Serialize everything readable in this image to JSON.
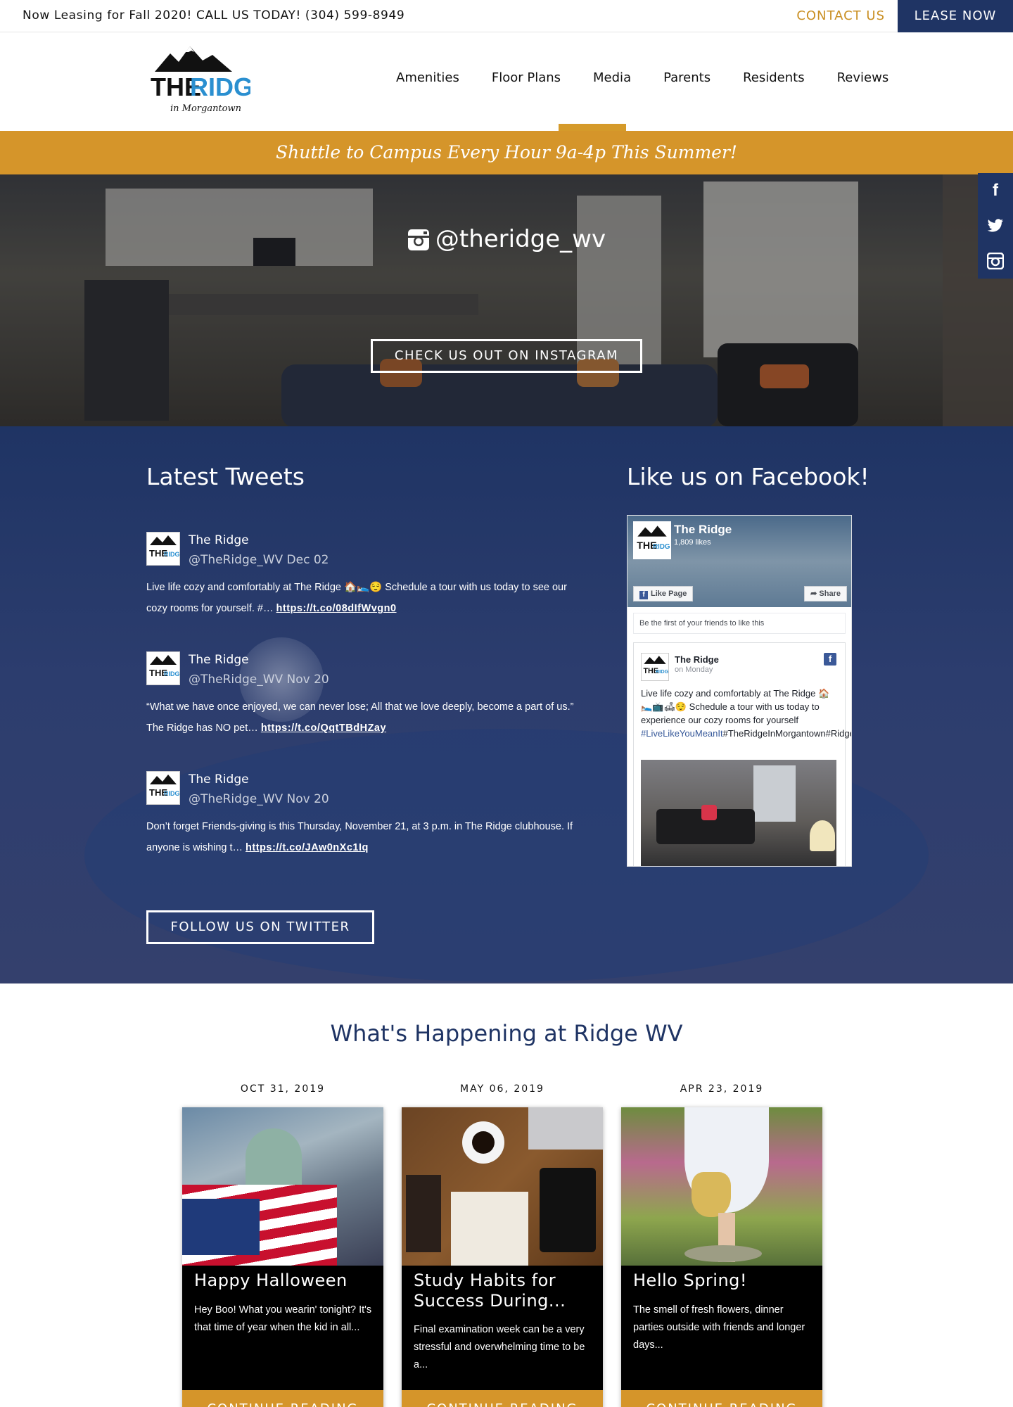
{
  "topbar": {
    "message": "Now Leasing for Fall 2020! CALL US TODAY! (304) 599-8949",
    "contact_label": "CONTACT US",
    "lease_label": "LEASE NOW"
  },
  "logo": {
    "line1": "THE",
    "line2": "RIDGE",
    "line3": "in Morgantown"
  },
  "nav": {
    "items": [
      "Amenities",
      "Floor Plans",
      "Media",
      "Parents",
      "Residents",
      "Reviews"
    ],
    "active": "Media"
  },
  "promo": {
    "text": "Shuttle to Campus Every Hour 9a-4p This Summer!"
  },
  "hero": {
    "instagram_handle": "@theridge_wv",
    "button_label": "CHECK US OUT ON INSTAGRAM"
  },
  "social_sidebar": {
    "items": [
      "facebook-icon",
      "twitter-icon",
      "instagram-icon"
    ]
  },
  "tweets_section": {
    "title": "Latest Tweets",
    "button_label": "FOLLOW US ON TWITTER",
    "tweets": [
      {
        "name": "The Ridge",
        "handle_date": "@TheRidge_WV Dec 02",
        "text": "Live life cozy and comfortably at The Ridge 🏠🛌😌 Schedule a tour with us today to see our cozy rooms for yourself. #…",
        "link": "https://t.co/08dIfWvgn0"
      },
      {
        "name": "The Ridge",
        "handle_date": "@TheRidge_WV Nov 20",
        "text": "“What we have once enjoyed, we can never lose; All that we love deeply, become a part of us.” The Ridge has NO pet…",
        "link": "https://t.co/QqtTBdHZay"
      },
      {
        "name": "The Ridge",
        "handle_date": "@TheRidge_WV Nov 20",
        "text": "Don’t forget Friends-giving is this Thursday, November 21, at 3 p.m. in The Ridge clubhouse. If anyone is wishing t…",
        "link": "https://t.co/JAw0nXc1Iq"
      }
    ]
  },
  "facebook_section": {
    "title": "Like us on Facebook!",
    "page_name": "The Ridge",
    "likes": "1,809 likes",
    "like_button": "Like Page",
    "share_button": "Share",
    "friends_text": "Be the first of your friends to like this",
    "post": {
      "author": "The Ridge",
      "date": "on Monday",
      "text": "Live life cozy and comfortably at The Ridge 🏠🛌📺🛋😌 Schedule a tour with us today to experience our cozy rooms for yourself",
      "hashtag": "#LiveLikeYouMeanIt",
      "tags_rest": "#TheRidgeInMorgantown#RidgeToTheRescue"
    }
  },
  "blog": {
    "title": "What's Happening at Ridge WV",
    "posts": [
      {
        "date": "OCT 31, 2019",
        "title": "Happy Halloween",
        "excerpt": "Hey Boo! What you wearin' tonight? It's that time of year when the kid in all...",
        "more": "CONTINUE READING"
      },
      {
        "date": "MAY 06, 2019",
        "title": "Study Habits for Success During...",
        "excerpt": "Final examination week can be a very stressful and overwhelming time to be a...",
        "more": "CONTINUE READING"
      },
      {
        "date": "APR 23, 2019",
        "title": "Hello Spring!",
        "excerpt": "The smell of fresh flowers, dinner parties outside with friends and longer days...",
        "more": "CONTINUE READING"
      }
    ]
  },
  "colors": {
    "navy": "#1f3464",
    "gold": "#d5952a",
    "contact_gold": "#c98f22"
  }
}
